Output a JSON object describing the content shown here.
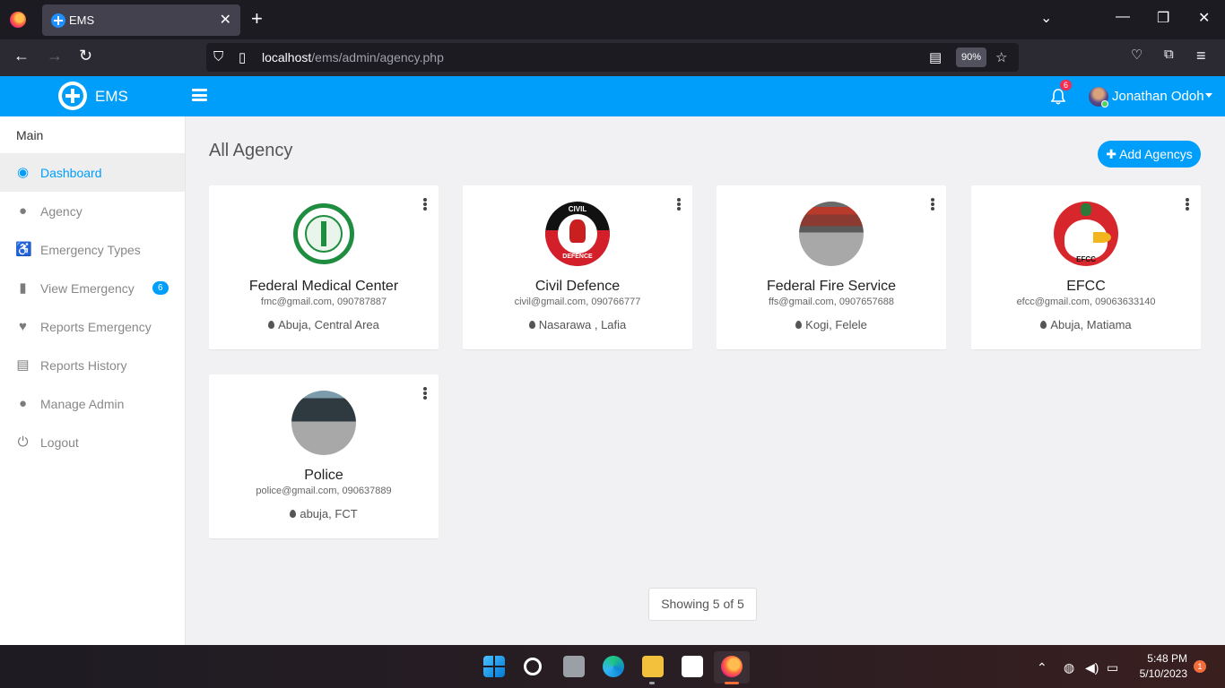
{
  "browser": {
    "tab_title": "EMS",
    "url_host": "localhost",
    "url_path": "/ems/admin/agency.php",
    "zoom": "90%"
  },
  "header": {
    "brand": "EMS",
    "notification_count": "6",
    "user_name": "Jonathan Odoh"
  },
  "sidebar": {
    "section_title": "Main",
    "items": [
      {
        "label": "Dashboard",
        "icon": "dashboard-icon"
      },
      {
        "label": "Agency",
        "icon": "user-icon"
      },
      {
        "label": "Emergency Types",
        "icon": "wheelchair-icon"
      },
      {
        "label": "View Emergency",
        "icon": "file-icon",
        "badge": "6"
      },
      {
        "label": "Reports Emergency",
        "icon": "heartbeat-icon"
      },
      {
        "label": "Reports History",
        "icon": "document-icon"
      },
      {
        "label": "Manage Admin",
        "icon": "user-plus-icon"
      },
      {
        "label": "Logout",
        "icon": "power-icon"
      }
    ]
  },
  "main": {
    "title": "All Agency",
    "add_button": "Add Agencys",
    "agencies": [
      {
        "name": "Federal Medical Center",
        "contact": "fmc@gmail.com, 090787887",
        "location": "Abuja, Central Area"
      },
      {
        "name": "Civil Defence",
        "contact": "civil@gmail.com, 090766777",
        "location": "Nasarawa , Lafia"
      },
      {
        "name": "Federal Fire Service",
        "contact": "ffs@gmail.com, 0907657688",
        "location": "Kogi, Felele"
      },
      {
        "name": "EFCC",
        "contact": "efcc@gmail.com, 09063633140",
        "location": "Abuja, Matiama"
      },
      {
        "name": "Police",
        "contact": "police@gmail.com, 090637889",
        "location": "abuja, FCT"
      }
    ],
    "logo_texts": {
      "civil_top": "CIVIL",
      "civil_bottom": "DEFENCE",
      "efcc": "EFCC"
    },
    "pagination": "Showing 5 of 5"
  },
  "taskbar": {
    "time": "5:48 PM",
    "date": "5/10/2023",
    "notifications": "1"
  },
  "colors": {
    "primary": "#009efb",
    "badge_red": "#f62d51"
  }
}
